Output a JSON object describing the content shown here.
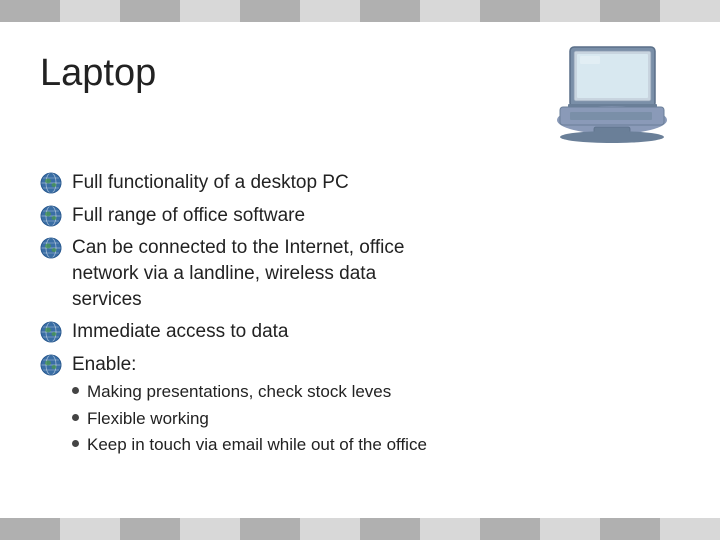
{
  "title": "Laptop",
  "bullets": [
    {
      "text": "Full functionality of a desktop PC"
    },
    {
      "text": "Full range of office software"
    },
    {
      "text": "Can be connected to the Internet, office network via a landline, wireless data services"
    },
    {
      "text": "Immediate access to data"
    },
    {
      "text": "Enable:",
      "sub": [
        "Making presentations, check stock leves",
        "Flexible working",
        "Keep in touch via email while out of the office"
      ]
    }
  ],
  "decorative_bar_segments": 12
}
